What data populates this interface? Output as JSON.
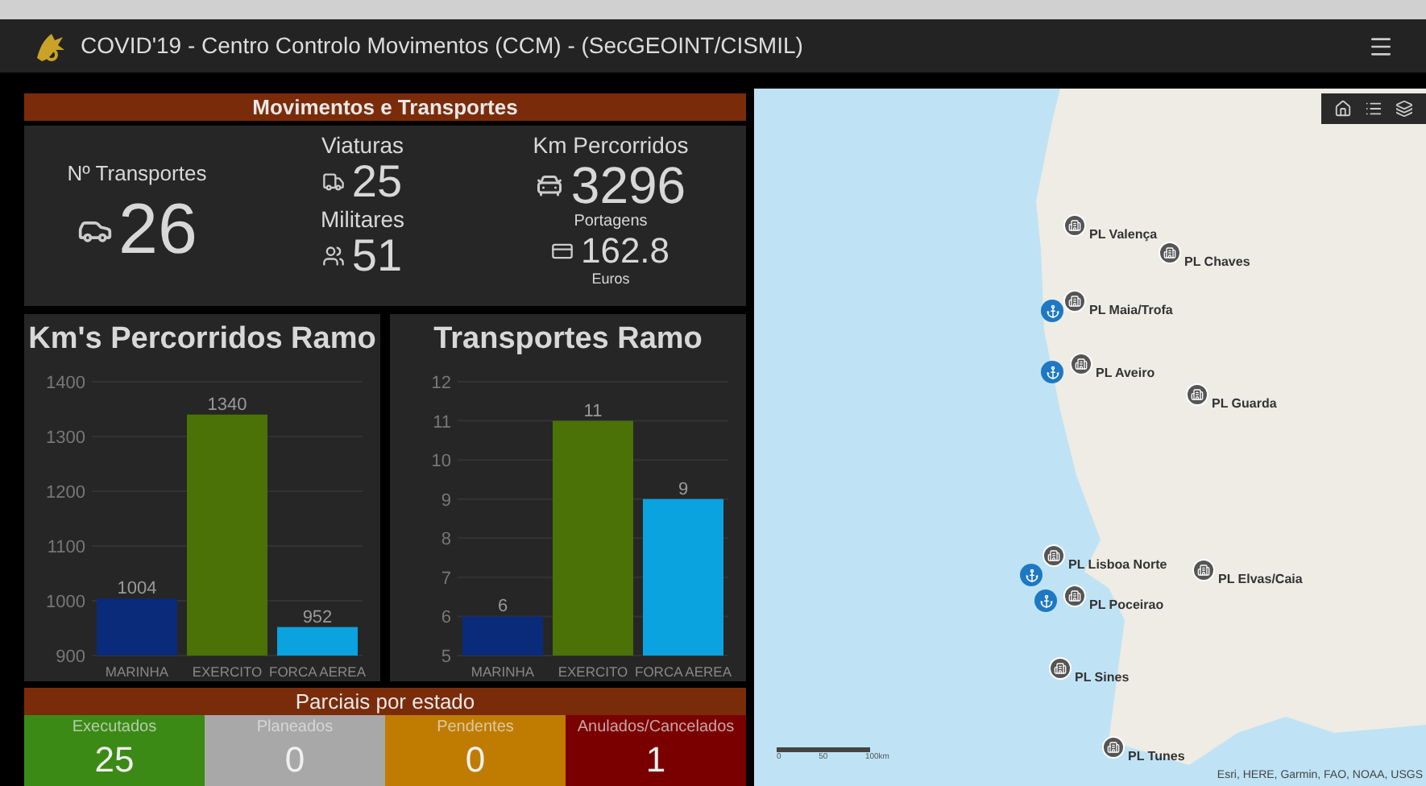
{
  "header": {
    "title": "COVID'19 - Centro Controlo Movimentos (CCM) - (SecGEOINT/CISMIL)"
  },
  "section": {
    "title": "Movimentos e Transportes"
  },
  "stats": {
    "transportes": {
      "label": "Nº Transportes",
      "value": "26"
    },
    "viaturas": {
      "label": "Viaturas",
      "value": "25"
    },
    "militares": {
      "label": "Militares",
      "value": "51"
    },
    "km": {
      "label": "Km Percorridos",
      "value": "3296"
    },
    "portagens": {
      "label": "Portagens",
      "value": "162.8",
      "unit": "Euros"
    }
  },
  "charts": [
    {
      "title": "Km's Percorridos Ramo",
      "chart_data": {
        "type": "bar",
        "categories": [
          "MARINHA",
          "EXERCITO",
          "FORCA AEREA"
        ],
        "values": [
          1004,
          1340,
          952
        ],
        "colors": [
          "#0a2a7a",
          "#4a7206",
          "#0aa3e0"
        ],
        "ylim": [
          900,
          1400
        ],
        "yticks": [
          900,
          1000,
          1100,
          1200,
          1300,
          1400
        ],
        "grid": true,
        "data_labels": true
      }
    },
    {
      "title": "Transportes Ramo",
      "chart_data": {
        "type": "bar",
        "categories": [
          "MARINHA",
          "EXERCITO",
          "FORCA AEREA"
        ],
        "values": [
          6,
          11,
          9
        ],
        "colors": [
          "#0a2a7a",
          "#4a7206",
          "#0aa3e0"
        ],
        "ylim": [
          5,
          12
        ],
        "yticks": [
          5,
          6,
          7,
          8,
          9,
          10,
          11,
          12
        ],
        "grid": true,
        "data_labels": true
      }
    }
  ],
  "status": {
    "title": "Parciais por estado",
    "items": [
      {
        "label": "Executados",
        "value": "25",
        "color": "#3b8a16"
      },
      {
        "label": "Planeados",
        "value": "0",
        "color": "#a8a8a8"
      },
      {
        "label": "Pendentes",
        "value": "0",
        "color": "#c07c00"
      },
      {
        "label": "Anulados/Cancelados",
        "value": "1",
        "color": "#7a0000"
      }
    ]
  },
  "map": {
    "markers": [
      {
        "label": "PL Valença",
        "kind": "building"
      },
      {
        "label": "PL Chaves",
        "kind": "building"
      },
      {
        "label": "PL Maia/Trofa",
        "kind": "building"
      },
      {
        "label": "PL Aveiro",
        "kind": "building"
      },
      {
        "label": "PL Guarda",
        "kind": "building"
      },
      {
        "label": "PL Lisboa Norte",
        "kind": "building"
      },
      {
        "label": "PL Elvas/Caia",
        "kind": "building"
      },
      {
        "label": "PL Poceirao",
        "kind": "building"
      },
      {
        "label": "PL Sines",
        "kind": "building"
      },
      {
        "label": "PL Tunes",
        "kind": "building"
      },
      {
        "kind": "anchor"
      },
      {
        "kind": "anchor"
      },
      {
        "kind": "anchor"
      },
      {
        "kind": "anchor"
      }
    ],
    "scale": [
      "0",
      "50",
      "100km"
    ],
    "attribution": "Esri, HERE, Garmin, FAO, NOAA, USGS"
  }
}
